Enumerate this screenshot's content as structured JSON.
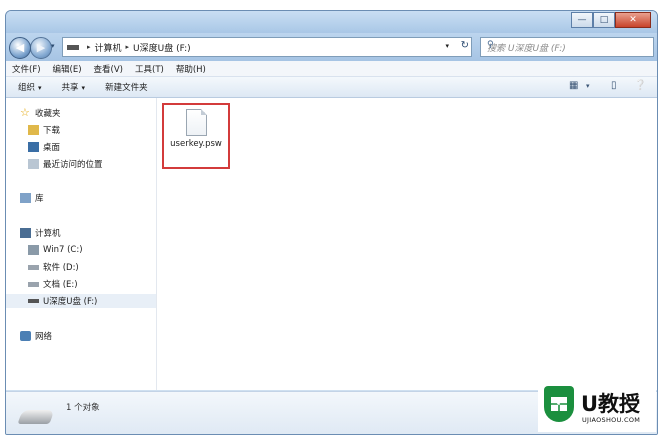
{
  "window": {
    "controls": {
      "minimize": "—",
      "maximize": "□",
      "close": "✕"
    }
  },
  "address": {
    "crumbs": [
      "计算机",
      "U深度U盘 (F:)"
    ],
    "separator": "▸",
    "search_placeholder": "搜索 U深度U盘 (F:)"
  },
  "menu": [
    "文件(F)",
    "编辑(E)",
    "查看(V)",
    "工具(T)",
    "帮助(H)"
  ],
  "toolbar": {
    "organize": "组织",
    "share": "共享",
    "new_folder": "新建文件夹"
  },
  "nav": {
    "favorites": "收藏夹",
    "downloads": "下载",
    "desktop": "桌面",
    "recent": "最近访问的位置",
    "libraries": "库",
    "computer": "计算机",
    "drive_c": "Win7 (C:)",
    "drive_d": "软件 (D:)",
    "drive_e": "文档 (E:)",
    "drive_f": "U深度U盘 (F:)",
    "network": "网络"
  },
  "content": {
    "file_name": "userkey.psw"
  },
  "status": {
    "count": "1 个对象"
  },
  "logo": {
    "text": "U教授",
    "url": "UJIAOSHOU.COM"
  }
}
